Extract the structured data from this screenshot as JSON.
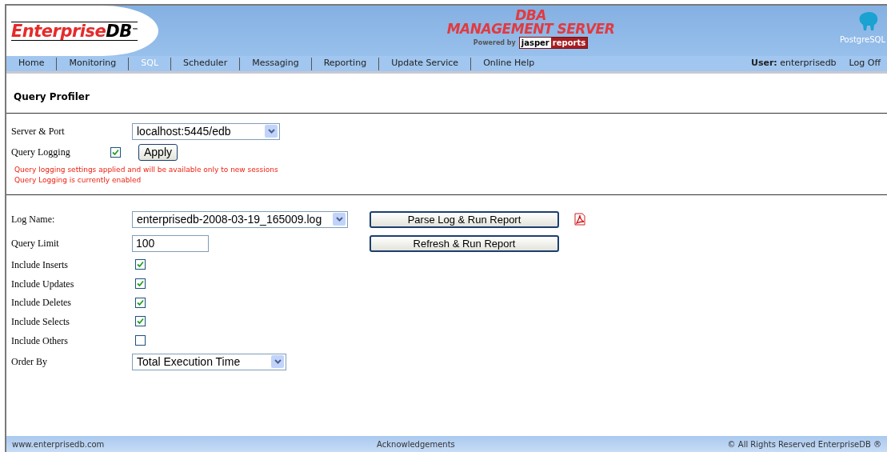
{
  "header": {
    "logo": {
      "name": "Enterprise",
      "suffix": "DB",
      "tm": "™"
    },
    "title_lines": [
      "DBA",
      "MANAGEMENT SERVER"
    ],
    "powered_by": "Powered by",
    "jasper": {
      "left": "jasper",
      "right": "reports"
    },
    "postgres": "PostgreSQL"
  },
  "nav": [
    {
      "label": "Home",
      "selected": false
    },
    {
      "label": "Monitoring",
      "selected": false
    },
    {
      "label": "SQL",
      "selected": true
    },
    {
      "label": "Scheduler",
      "selected": false
    },
    {
      "label": "Messaging",
      "selected": false
    },
    {
      "label": "Reporting",
      "selected": false
    },
    {
      "label": "Update Service",
      "selected": false
    },
    {
      "label": "Online Help",
      "selected": false
    }
  ],
  "user": {
    "label": "User:",
    "name": "enterprisedb"
  },
  "log_off": "Log Off",
  "page_title": "Query Profiler",
  "settings": {
    "server": {
      "label": "Server & Port",
      "value": "localhost:5445/edb"
    },
    "logging": {
      "label": "Query Logging",
      "checked": true
    },
    "apply": "Apply",
    "messages": [
      "Query logging settings applied and will be available only to new sessions",
      "Query Logging is currently enabled"
    ]
  },
  "report": [
    {
      "kind": "select",
      "label": "Log Name:",
      "value": "enterprisedb-2008-03-19_165009.log",
      "button": "Parse Log & Run Report",
      "pdf": true
    },
    {
      "kind": "input",
      "label": "Query Limit",
      "value": "100",
      "button": "Refresh & Run Report"
    },
    {
      "kind": "checkbox",
      "label": "Include Inserts",
      "checked": true
    },
    {
      "kind": "checkbox",
      "label": "Include Updates",
      "checked": true
    },
    {
      "kind": "checkbox",
      "label": "Include Deletes",
      "checked": true
    },
    {
      "kind": "checkbox",
      "label": "Include Selects",
      "checked": true
    },
    {
      "kind": "checkbox",
      "label": "Include Others",
      "checked": false
    },
    {
      "kind": "select",
      "label": "Order By",
      "value": "Total Execution Time"
    }
  ],
  "footer": {
    "left": "www.enterprisedb.com",
    "center": "Acknowledgements",
    "right": "© All Rights Reserved EnterpriseDB ®"
  }
}
